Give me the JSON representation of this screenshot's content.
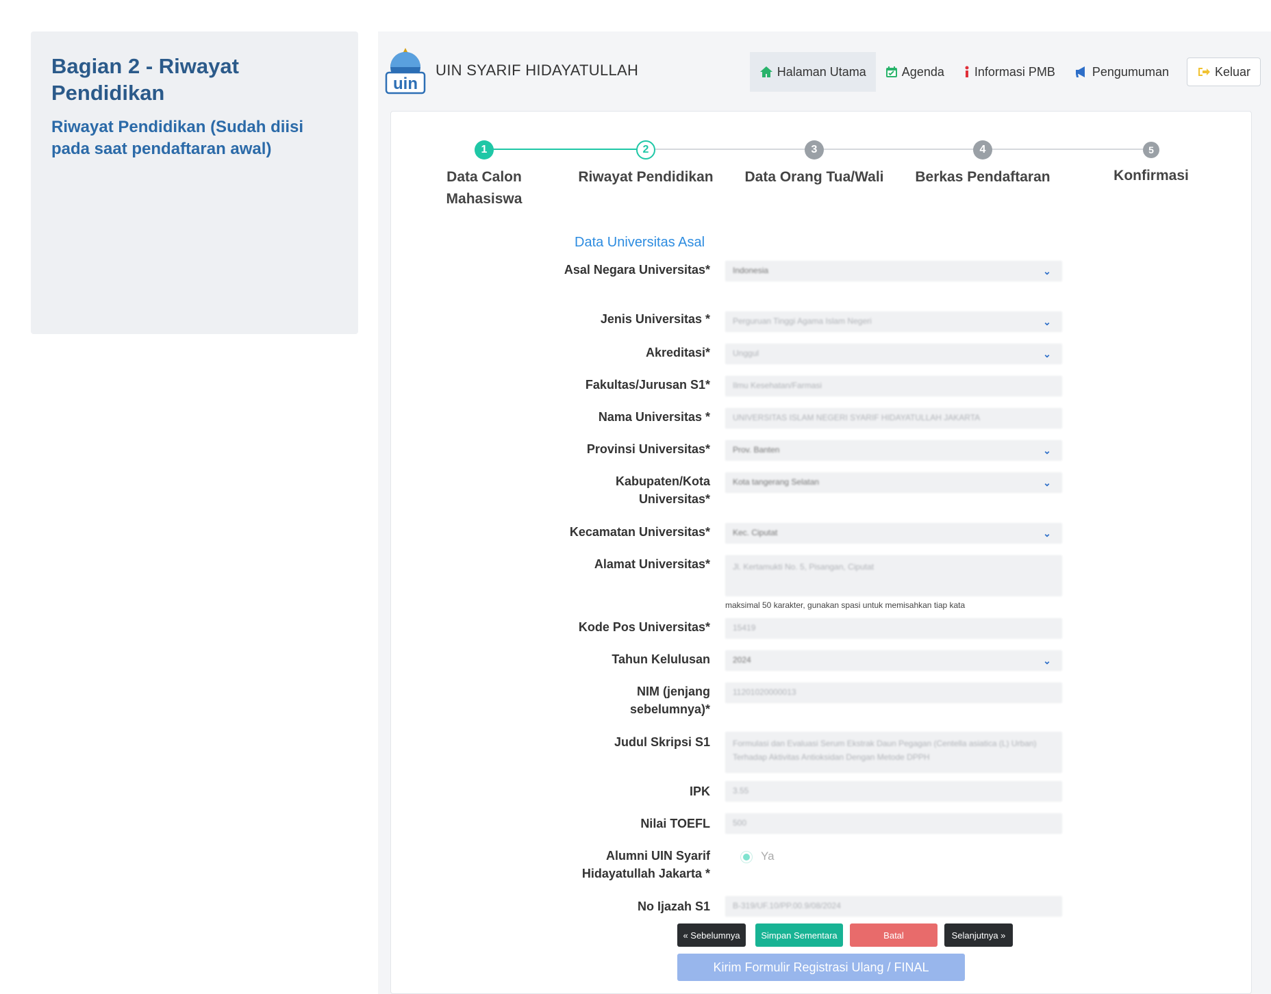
{
  "side": {
    "title": "Bagian 2 - Riwayat Pendidikan",
    "subtitle": "Riwayat Pendidikan (Sudah diisi pada saat pendaftaran awal)"
  },
  "header": {
    "brand": "UIN SYARIF HIDAYATULLAH",
    "logo_text": "uin",
    "nav": {
      "home": "Halaman Utama",
      "agenda": "Agenda",
      "info": "Informasi PMB",
      "announce": "Pengumuman",
      "logout": "Keluar"
    }
  },
  "stepper": {
    "steps": [
      {
        "num": "1",
        "label": "Data Calon Mahasiswa"
      },
      {
        "num": "2",
        "label": "Riwayat Pendidikan"
      },
      {
        "num": "3",
        "label": "Data Orang Tua/Wali"
      },
      {
        "num": "4",
        "label": "Berkas Pendaftaran"
      },
      {
        "num": "5",
        "label": "Konfirmasi"
      }
    ],
    "colors": {
      "done": "#1fc7a6",
      "pending": "#9aa0a6"
    }
  },
  "form": {
    "section_title": "Data Universitas Asal",
    "fields": {
      "country": {
        "label": "Asal Negara Universitas*",
        "value": "Indonesia"
      },
      "uni_type": {
        "label": "Jenis Universitas *",
        "value": "Perguruan Tinggi Agama Islam Negeri"
      },
      "accreditation": {
        "label": "Akreditasi*",
        "value": "Unggul"
      },
      "faculty": {
        "label": "Fakultas/Jurusan S1*",
        "value": "Ilmu Kesehatan/Farmasi"
      },
      "uni_name": {
        "label": "Nama Universitas *",
        "value": "UNIVERSITAS ISLAM NEGERI SYARIF HIDAYATULLAH JAKARTA"
      },
      "province": {
        "label": "Provinsi Universitas*",
        "value": "Prov. Banten"
      },
      "city": {
        "label": "Kabupaten/Kota Universitas*",
        "value": "Kota tangerang Selatan"
      },
      "district": {
        "label": "Kecamatan Universitas*",
        "value": "Kec. Ciputat"
      },
      "address": {
        "label": "Alamat Universitas*",
        "value": "Jl. Kertamukti No. 5, Pisangan, Ciputat",
        "hint": "maksimal 50 karakter, gunakan spasi untuk memisahkan tiap kata"
      },
      "postal": {
        "label": "Kode Pos Universitas*",
        "value": "15419"
      },
      "grad_year": {
        "label": "Tahun Kelulusan",
        "value": "2024"
      },
      "nim": {
        "label": "NIM (jenjang sebelumnya)*",
        "value": "11201020000013"
      },
      "thesis": {
        "label": "Judul Skripsi S1",
        "value": "Formulasi dan Evaluasi Serum Ekstrak Daun Pegagan (Centella asiatica (L) Urban) Terhadap Aktivitas Antioksidan Dengan Metode DPPH"
      },
      "gpa": {
        "label": "IPK",
        "value": "3.55"
      },
      "toefl": {
        "label": "Nilai TOEFL",
        "value": "500"
      },
      "alumni": {
        "label": "Alumni UIN Syarif Hidayatullah Jakarta *",
        "option": "Ya"
      },
      "diploma": {
        "label": "No Ijazah S1",
        "value": "B-319/UF.10/PP.00.9/08/2024"
      }
    }
  },
  "buttons": {
    "prev": "« Sebelumnya",
    "save": "Simpan Sementara",
    "cancel": "Batal",
    "next": "Selanjutnya »",
    "final": "Kirim Formulir Registrasi Ulang / FINAL"
  }
}
